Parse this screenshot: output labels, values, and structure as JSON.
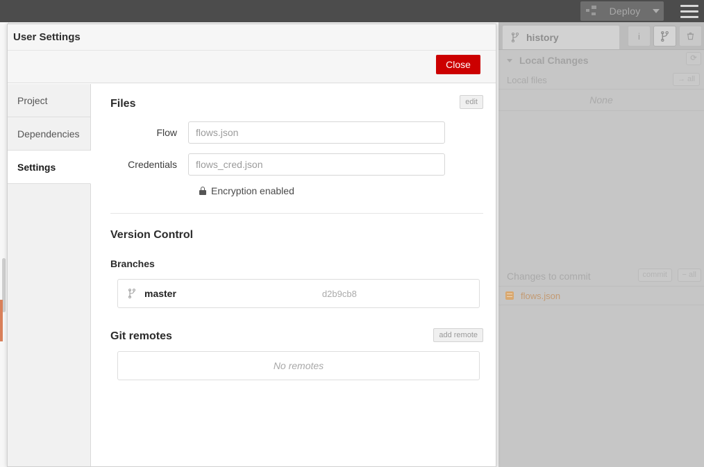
{
  "topbar": {
    "deploy_label": "Deploy",
    "deploy_icon": "deploy-icon",
    "caret_icon": "chevron-down-icon",
    "menu_icon": "hamburger-menu-icon"
  },
  "dialog": {
    "title": "User Settings",
    "close_label": "Close",
    "tabs": [
      {
        "label": "Project",
        "active": false
      },
      {
        "label": "Dependencies",
        "active": false
      },
      {
        "label": "Settings",
        "active": true
      }
    ],
    "files": {
      "heading": "Files",
      "edit_label": "edit",
      "flow_label": "Flow",
      "flow_value": "flows.json",
      "credentials_label": "Credentials",
      "credentials_value": "flows_cred.json",
      "encryption_text": "Encryption enabled",
      "lock_icon": "lock-icon"
    },
    "version_control": {
      "heading": "Version Control",
      "branches_heading": "Branches",
      "branch_icon": "git-branch-icon",
      "branch_name": "master",
      "branch_hash": "d2b9cb8",
      "remotes_heading": "Git remotes",
      "add_remote_label": "add remote",
      "no_remotes_text": "No remotes"
    }
  },
  "sidebar": {
    "tab_label": "history",
    "tab_icon": "git-branch-icon",
    "tools": [
      {
        "name": "info-icon",
        "glyph": "i",
        "selected": false
      },
      {
        "name": "git-branch-icon",
        "glyph": "⅄",
        "selected": true
      },
      {
        "name": "history-clock-icon",
        "glyph": "⚗",
        "selected": false
      }
    ],
    "local_changes_heading": "Local Changes",
    "local_changes_pill": "⟳",
    "local_files_label": "Local files",
    "local_files_pill": "→ all",
    "none_text": "None",
    "changes_to_commit_label": "Changes to commit",
    "commit_label": "commit",
    "unstage_label": "− all",
    "commit_files": [
      {
        "name": "flows.json",
        "icon": "file-icon"
      }
    ]
  },
  "colors": {
    "close_red": "#cc0000",
    "topbar": "#4c4c4c",
    "sidebar_disabled": "#c6c6c6",
    "file_orange": "#d9a86f"
  }
}
